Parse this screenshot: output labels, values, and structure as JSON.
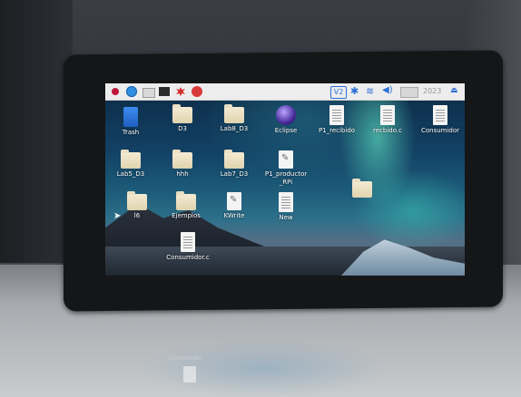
{
  "taskbar": {
    "left_icons": [
      "raspberry-menu-icon",
      "web-browser-icon",
      "file-manager-icon",
      "terminal-icon",
      "bug-app-icon",
      "app-icon"
    ],
    "vnc_label": "V2",
    "clock": "2023",
    "colors": {
      "bar": "#ededed",
      "accent": "#2c6fd6"
    }
  },
  "desktop": {
    "icons": [
      {
        "label": "Trash",
        "type": "trash"
      },
      {
        "label": "D3",
        "type": "folder"
      },
      {
        "label": "Lab8_D3",
        "type": "folder"
      },
      {
        "label": "Eclipse",
        "type": "app"
      },
      {
        "label": "P1_recibido",
        "type": "doc"
      },
      {
        "label": "recbido.c",
        "type": "doc"
      },
      {
        "label": "Consumidor",
        "type": "doc"
      },
      {
        "label": "Lab5_D3",
        "type": "folder"
      },
      {
        "label": "hhh",
        "type": "folder"
      },
      {
        "label": "Lab7_D3",
        "type": "folder"
      },
      {
        "label": "P1_productor _RPi",
        "type": "pen"
      },
      {
        "label": "l6",
        "type": "folder"
      },
      {
        "label": "Ejemplos",
        "type": "folder"
      },
      {
        "label": "KWrite",
        "type": "pen"
      },
      {
        "label": "New",
        "type": "doc"
      },
      {
        "label": "Consumidor.c",
        "type": "doc"
      }
    ]
  },
  "reflection": {
    "label": "Consumidor"
  }
}
